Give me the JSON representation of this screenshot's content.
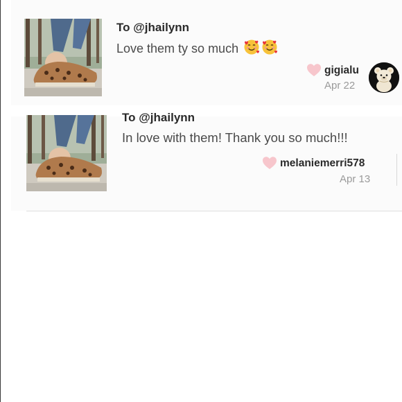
{
  "comments": [
    {
      "recipient": "To @jhailynn",
      "message": "Love them ty so much",
      "emojis": [
        "smiling-face-with-hearts-icon",
        "smiling-face-with-hearts-icon"
      ],
      "username": "gigialu",
      "date": "Apr 22",
      "has_avatar": true
    },
    {
      "recipient": "To @jhailynn",
      "message": "In love with them! Thank you so much!!!",
      "username": "melaniemerri578",
      "date": "Apr 13",
      "has_avatar": false
    }
  ],
  "colors": {
    "heart": "#f7c6cc",
    "username": "#2a2a2a",
    "date": "#9a9a9a",
    "card_background": "#fbfbfb"
  }
}
